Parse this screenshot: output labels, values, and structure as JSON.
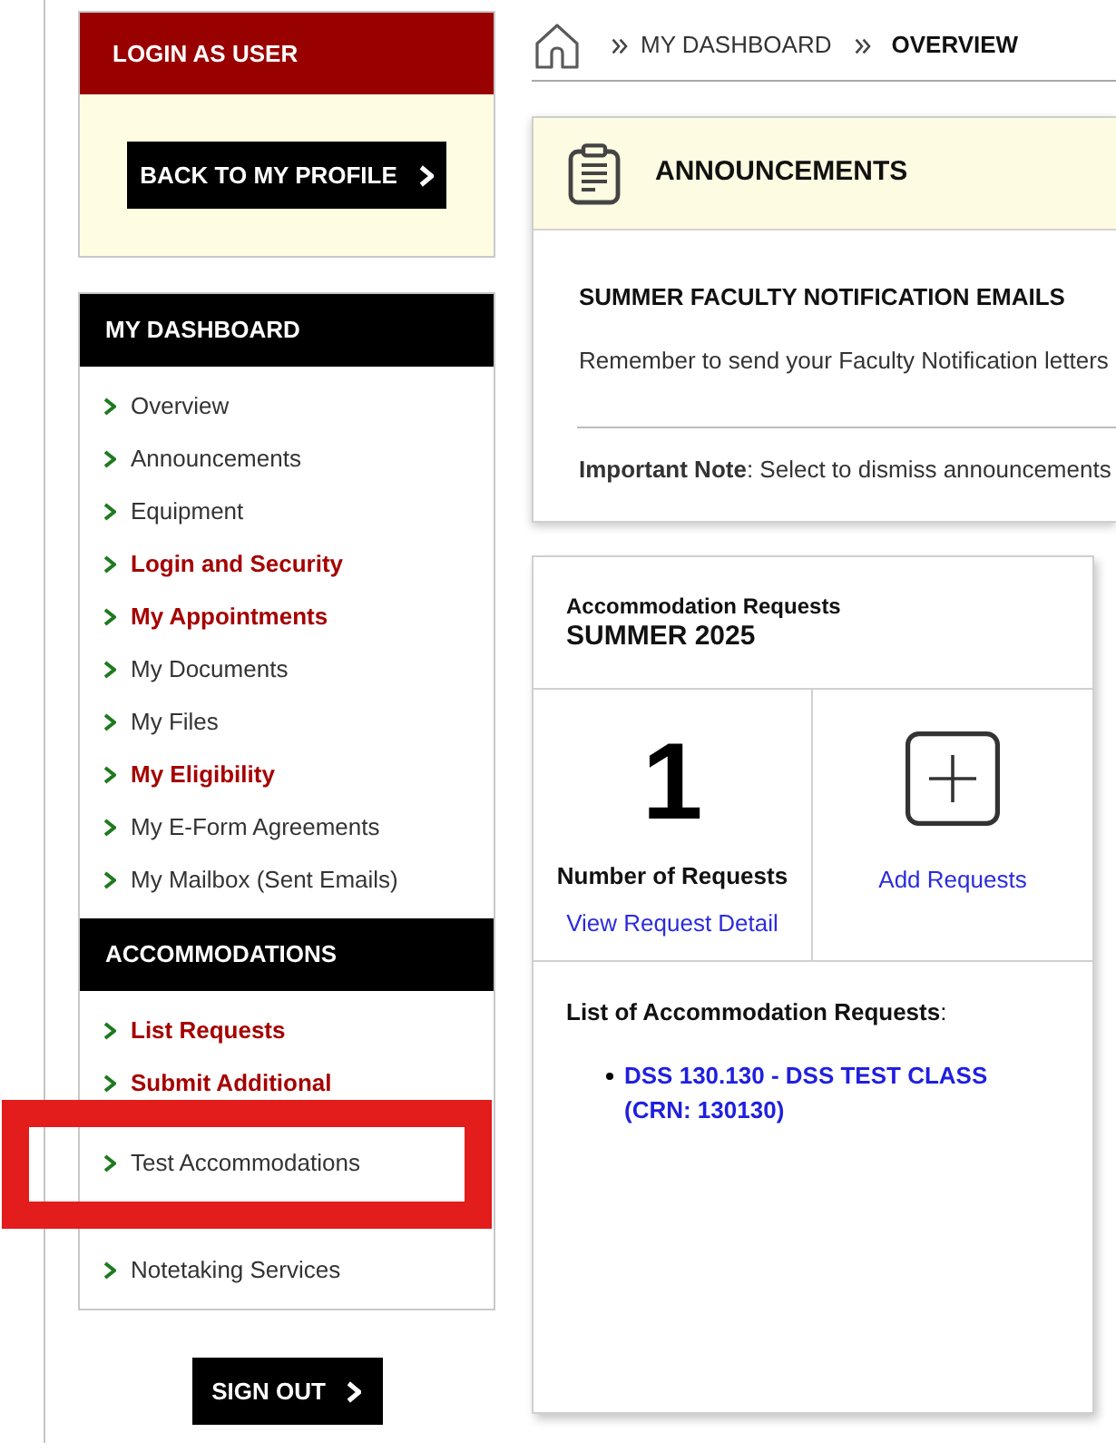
{
  "login_panel": {
    "title": "LOGIN AS USER",
    "button": "BACK TO MY PROFILE"
  },
  "sidebar": {
    "sections": [
      {
        "title": "MY DASHBOARD",
        "items": [
          {
            "label": "Overview",
            "emphasized": false,
            "marked": false
          },
          {
            "label": "Announcements",
            "emphasized": false,
            "marked": false
          },
          {
            "label": "Equipment",
            "emphasized": false,
            "marked": false
          },
          {
            "label": "Login and Security",
            "emphasized": true,
            "marked": false
          },
          {
            "label": "My Appointments",
            "emphasized": true,
            "marked": false
          },
          {
            "label": "My Documents",
            "emphasized": false,
            "marked": false
          },
          {
            "label": "My Files",
            "emphasized": false,
            "marked": false
          },
          {
            "label": "My Eligibility",
            "emphasized": true,
            "marked": false
          },
          {
            "label": "My E-Form Agreements",
            "emphasized": false,
            "marked": false
          },
          {
            "label": "My Mailbox (Sent Emails)",
            "emphasized": false,
            "marked": false
          }
        ]
      },
      {
        "title": "ACCOMMODATIONS",
        "items": [
          {
            "label": "List Requests",
            "emphasized": true,
            "marked": false
          },
          {
            "label": "Submit Additional",
            "emphasized": true,
            "marked": false
          },
          {
            "label": "Test Accommodations",
            "emphasized": false,
            "marked": true
          },
          {
            "label": "Notetaking Services",
            "emphasized": false,
            "marked": false
          }
        ]
      }
    ]
  },
  "sign_out_button": "SIGN OUT",
  "breadcrumb": [
    {
      "label": "MY DASHBOARD",
      "current": false
    },
    {
      "label": "OVERVIEW",
      "current": true
    }
  ],
  "announcements": {
    "title": "ANNOUNCEMENTS",
    "items": [
      {
        "title": "SUMMER FACULTY NOTIFICATION EMAILS",
        "text": "Remember to send your Faculty Notification letters"
      }
    ],
    "note": "**Important Note**: Select to dismiss announcements"
  },
  "accommodation_requests": {
    "title": "Accommodation Requests",
    "term": "SUMMER 2025",
    "count": "1",
    "count_label": "Number of Requests",
    "detail_link": "View Request Detail",
    "add_link": "Add Requests",
    "list_title": "**List of Accommodation Requests**:",
    "requests": [
      "DSS 130.130 - DSS TEST CLASS (CRN: 130130)"
    ]
  }
}
